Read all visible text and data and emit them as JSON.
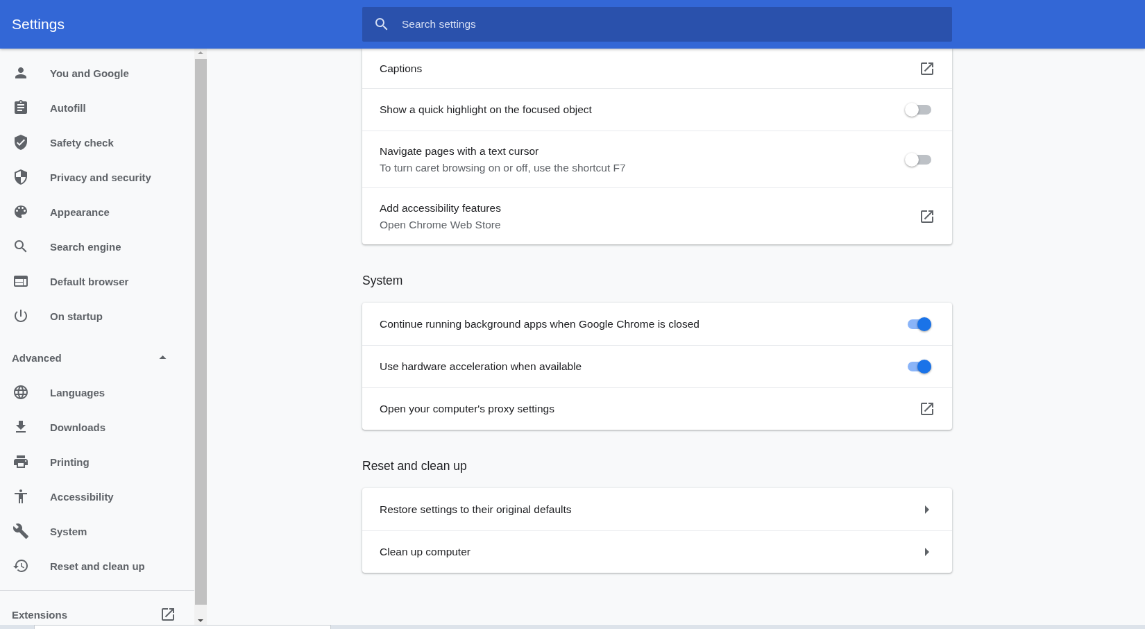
{
  "header": {
    "title": "Settings",
    "search": {
      "placeholder": "Search settings"
    }
  },
  "sidebar": {
    "items": [
      {
        "label": "You and Google"
      },
      {
        "label": "Autofill"
      },
      {
        "label": "Safety check"
      },
      {
        "label": "Privacy and security"
      },
      {
        "label": "Appearance"
      },
      {
        "label": "Search engine"
      },
      {
        "label": "Default browser"
      },
      {
        "label": "On startup"
      }
    ],
    "advanced": {
      "label": "Advanced",
      "expanded": true
    },
    "advanced_items": [
      {
        "label": "Languages"
      },
      {
        "label": "Downloads"
      },
      {
        "label": "Printing"
      },
      {
        "label": "Accessibility"
      },
      {
        "label": "System"
      },
      {
        "label": "Reset and clean up"
      }
    ],
    "extensions": {
      "label": "Extensions"
    }
  },
  "sections": [
    {
      "rows": [
        {
          "kind": "external",
          "label": "Captions"
        },
        {
          "kind": "toggle",
          "label": "Show a quick highlight on the focused object",
          "on": false
        },
        {
          "kind": "toggle",
          "label": "Navigate pages with a text cursor",
          "description": "To turn caret browsing on or off, use the shortcut F7",
          "on": false
        },
        {
          "kind": "external",
          "label": "Add accessibility features",
          "description": "Open Chrome Web Store"
        }
      ]
    },
    {
      "heading": "System",
      "rows": [
        {
          "kind": "toggle",
          "label": "Continue running background apps when Google Chrome is closed",
          "on": true
        },
        {
          "kind": "toggle",
          "label": "Use hardware acceleration when available",
          "on": true
        },
        {
          "kind": "external",
          "label": "Open your computer's proxy settings"
        }
      ]
    },
    {
      "heading": "Reset and clean up",
      "rows": [
        {
          "kind": "submenu",
          "label": "Restore settings to their original defaults"
        },
        {
          "kind": "submenu",
          "label": "Clean up computer"
        }
      ]
    }
  ]
}
